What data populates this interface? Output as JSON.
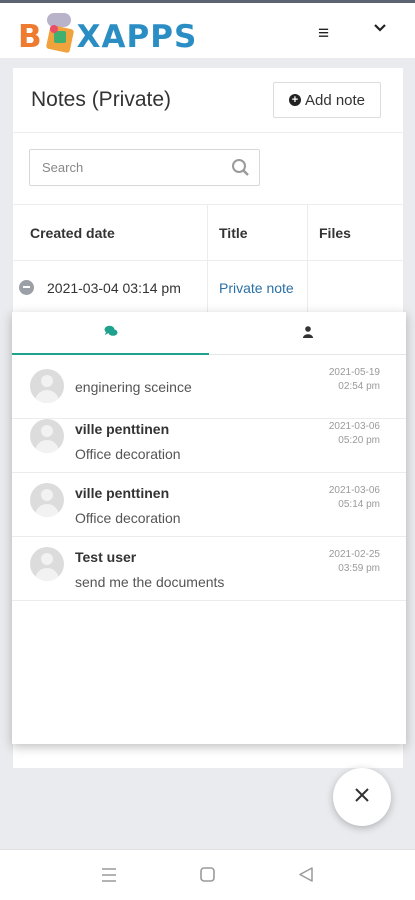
{
  "header": {
    "logo_left": "B",
    "logo_right": "XAPPS",
    "menu_glyph": "≡",
    "brand_colors": {
      "orange": "#ee7b30",
      "blue": "#2a8ec4"
    }
  },
  "notes": {
    "title": "Notes (Private)",
    "add_label": "Add note",
    "search_placeholder": "Search",
    "columns": [
      "Created date",
      "Title",
      "Files"
    ],
    "row": {
      "date": "2021-03-04 03:14 pm",
      "title": "Private note",
      "files": ""
    }
  },
  "chat": {
    "tabs": [
      {
        "name": "comments-icon",
        "active": true
      },
      {
        "name": "user-icon",
        "active": false
      }
    ],
    "accent": "#1fa28d",
    "messages": [
      {
        "name": "",
        "text": "enginering sceince",
        "date": "2021-05-19",
        "time": "02:54 pm"
      },
      {
        "name": "ville penttinen",
        "text": "Office decoration",
        "date": "2021-03-06",
        "time": "05:20 pm"
      },
      {
        "name": "ville penttinen",
        "text": "Office decoration",
        "date": "2021-03-06",
        "time": "05:14 pm"
      },
      {
        "name": "Test user",
        "text": "send me the documents",
        "date": "2021-02-25",
        "time": "03:59 pm"
      }
    ]
  },
  "fab": {
    "icon": "close-icon"
  },
  "android_nav": {
    "icons": [
      "recents-icon",
      "home-icon",
      "back-icon"
    ]
  }
}
